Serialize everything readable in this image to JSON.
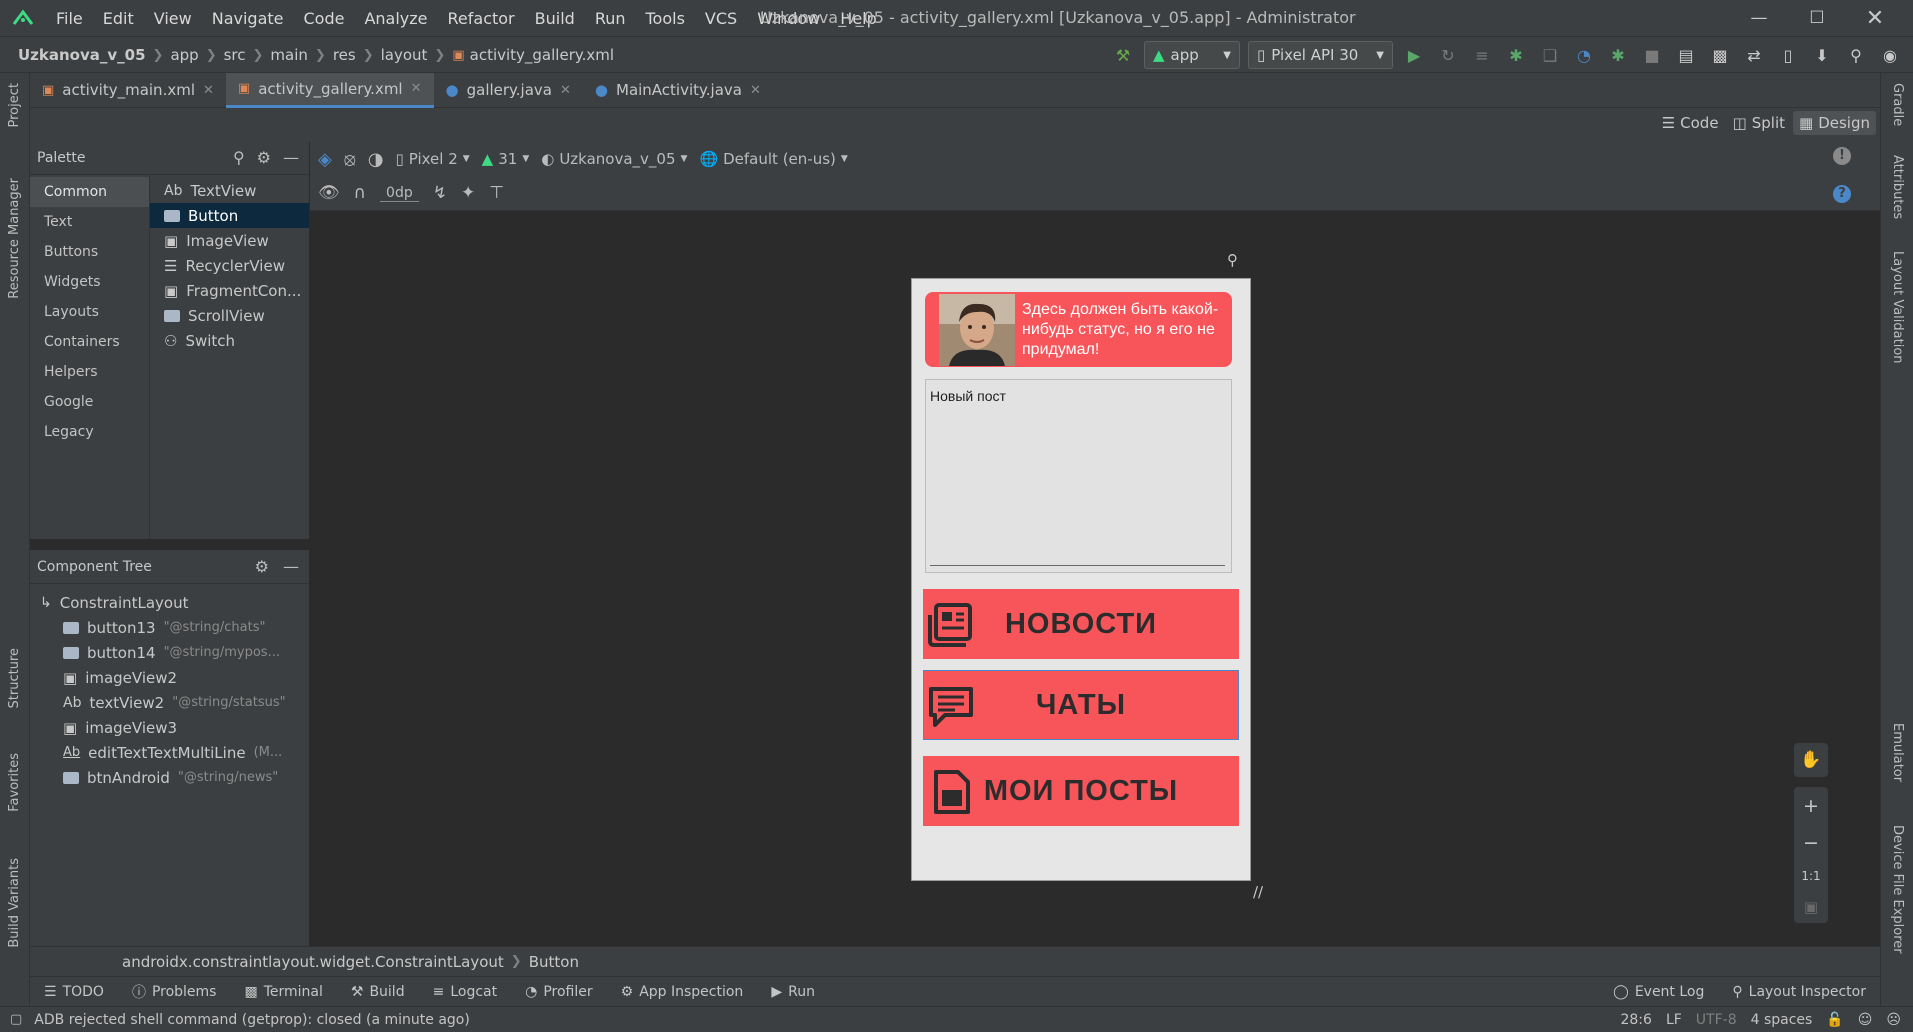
{
  "menu": [
    "File",
    "Edit",
    "View",
    "Navigate",
    "Code",
    "Analyze",
    "Refactor",
    "Build",
    "Run",
    "Tools",
    "VCS",
    "Window",
    "Help"
  ],
  "window_title": "Uzkanova_v_05 - activity_gallery.xml [Uzkanova_v_05.app] - Administrator",
  "breadcrumbs": [
    "Uzkanova_v_05",
    "app",
    "src",
    "main",
    "res",
    "layout",
    "activity_gallery.xml"
  ],
  "run_config": "app",
  "device": "Pixel API 30",
  "file_tabs": [
    {
      "label": "activity_main.xml",
      "kind": "xml"
    },
    {
      "label": "activity_gallery.xml",
      "kind": "xml",
      "active": true
    },
    {
      "label": "gallery.java",
      "kind": "java"
    },
    {
      "label": "MainActivity.java",
      "kind": "java"
    }
  ],
  "view_modes": {
    "code": "Code",
    "split": "Split",
    "design": "Design"
  },
  "palette": {
    "title": "Palette",
    "categories": [
      "Common",
      "Text",
      "Buttons",
      "Widgets",
      "Layouts",
      "Containers",
      "Helpers",
      "Google",
      "Legacy"
    ],
    "items": [
      {
        "prefix": "Ab",
        "label": "TextView"
      },
      {
        "label": "Button",
        "selected": true
      },
      {
        "label": "ImageView"
      },
      {
        "label": "RecyclerView"
      },
      {
        "label": "FragmentCon..."
      },
      {
        "label": "ScrollView"
      },
      {
        "label": "Switch"
      }
    ]
  },
  "component_tree": {
    "title": "Component Tree",
    "root": "ConstraintLayout",
    "nodes": [
      {
        "name": "button13",
        "attr": "\"@string/chats\""
      },
      {
        "name": "button14",
        "attr": "\"@string/mypos..."
      },
      {
        "name": "imageView2",
        "attr": ""
      },
      {
        "name": "textView2",
        "attr": "\"@string/statsus\""
      },
      {
        "name": "imageView3",
        "attr": ""
      },
      {
        "name": "editTextTextMultiLine",
        "attr": "(M..."
      },
      {
        "name": "btnAndroid",
        "attr": "\"@string/news\""
      }
    ]
  },
  "design_toolbar": {
    "device": "Pixel 2",
    "api": "31",
    "theme": "Uzkanova_v_05",
    "locale": "Default (en-us)",
    "margin": "0dp"
  },
  "phone": {
    "status_text": "Здесь должен быть какой-нибудь статус, но я его не придумал!",
    "new_post": "Новый пост",
    "btn_news": "НОВОСТИ",
    "btn_chats": "ЧАТЫ",
    "btn_posts": "МОИ ПОСТЫ"
  },
  "zoom": {
    "one_to_one": "1:1"
  },
  "bottom_breadcrumb": [
    "androidx.constraintlayout.widget.ConstraintLayout",
    "Button"
  ],
  "tool_windows": [
    "TODO",
    "Problems",
    "Terminal",
    "Build",
    "Logcat",
    "Profiler",
    "App Inspection",
    "Run"
  ],
  "tool_windows_right": [
    "Event Log",
    "Layout Inspector"
  ],
  "left_strip": [
    "Project",
    "Resource Manager",
    "Structure",
    "Favorites",
    "Build Variants"
  ],
  "right_strip": [
    "Gradle",
    "Attributes",
    "Layout Validation",
    "Emulator",
    "Device File Explorer"
  ],
  "status": {
    "message": "ADB rejected shell command (getprop): closed (a minute ago)",
    "pos": "28:6",
    "sep": "LF",
    "enc": "UTF-8",
    "indent": "4 spaces"
  },
  "colors": {
    "accent": "#4a88c7",
    "button_red": "#f7555a",
    "android_green": "#3ddc84"
  }
}
